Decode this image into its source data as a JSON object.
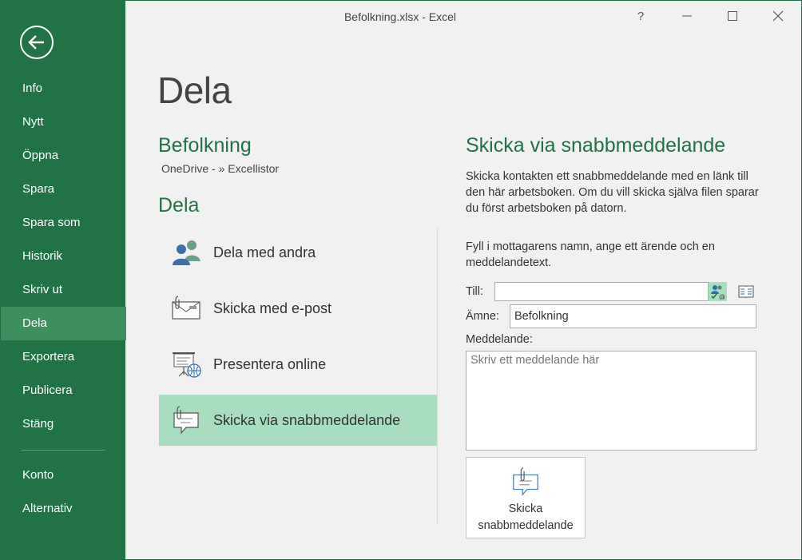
{
  "window": {
    "title": "Befolkning.xlsx - Excel",
    "help": "?",
    "minimize": "—",
    "maximize": "☐",
    "close": "✕"
  },
  "sidebar": {
    "items": [
      {
        "label": "Info"
      },
      {
        "label": "Nytt"
      },
      {
        "label": "Öppna"
      },
      {
        "label": "Spara"
      },
      {
        "label": "Spara som"
      },
      {
        "label": "Historik"
      },
      {
        "label": "Skriv ut"
      },
      {
        "label": "Dela",
        "active": true
      },
      {
        "label": "Exportera"
      },
      {
        "label": "Publicera"
      },
      {
        "label": "Stäng"
      },
      {
        "label": "Konto"
      },
      {
        "label": "Alternativ"
      }
    ]
  },
  "page": {
    "title": "Dela",
    "document_name": "Befolkning",
    "document_path": "OneDrive - » Excellistor",
    "section_title": "Dela",
    "options": [
      {
        "label": "Dela med andra",
        "icon": "people-icon"
      },
      {
        "label": "Skicka med e-post",
        "icon": "envelope-icon"
      },
      {
        "label": "Presentera online",
        "icon": "present-online-icon"
      },
      {
        "label": "Skicka via snabbmeddelande",
        "icon": "im-bubble-icon",
        "selected": true
      }
    ]
  },
  "panel": {
    "title": "Skicka via snabbmeddelande",
    "description": "Skicka kontakten ett snabbmeddelande med en länk till den här arbetsboken. Om du vill skicka själva filen sparar du först arbetsboken på datorn.",
    "instructions": "Fyll i mottagarens namn, ange ett ärende och en meddelandetext.",
    "to_label": "Till:",
    "to_value": "",
    "subject_label": "Ämne:",
    "subject_value": "Befolkning",
    "message_label": "Meddelande:",
    "message_placeholder": "Skriv ett meddelande här",
    "send_button_line1": "Skicka",
    "send_button_line2": "snabbmeddelande"
  },
  "colors": {
    "accent": "#217346",
    "selected": "#a8ddbf"
  }
}
